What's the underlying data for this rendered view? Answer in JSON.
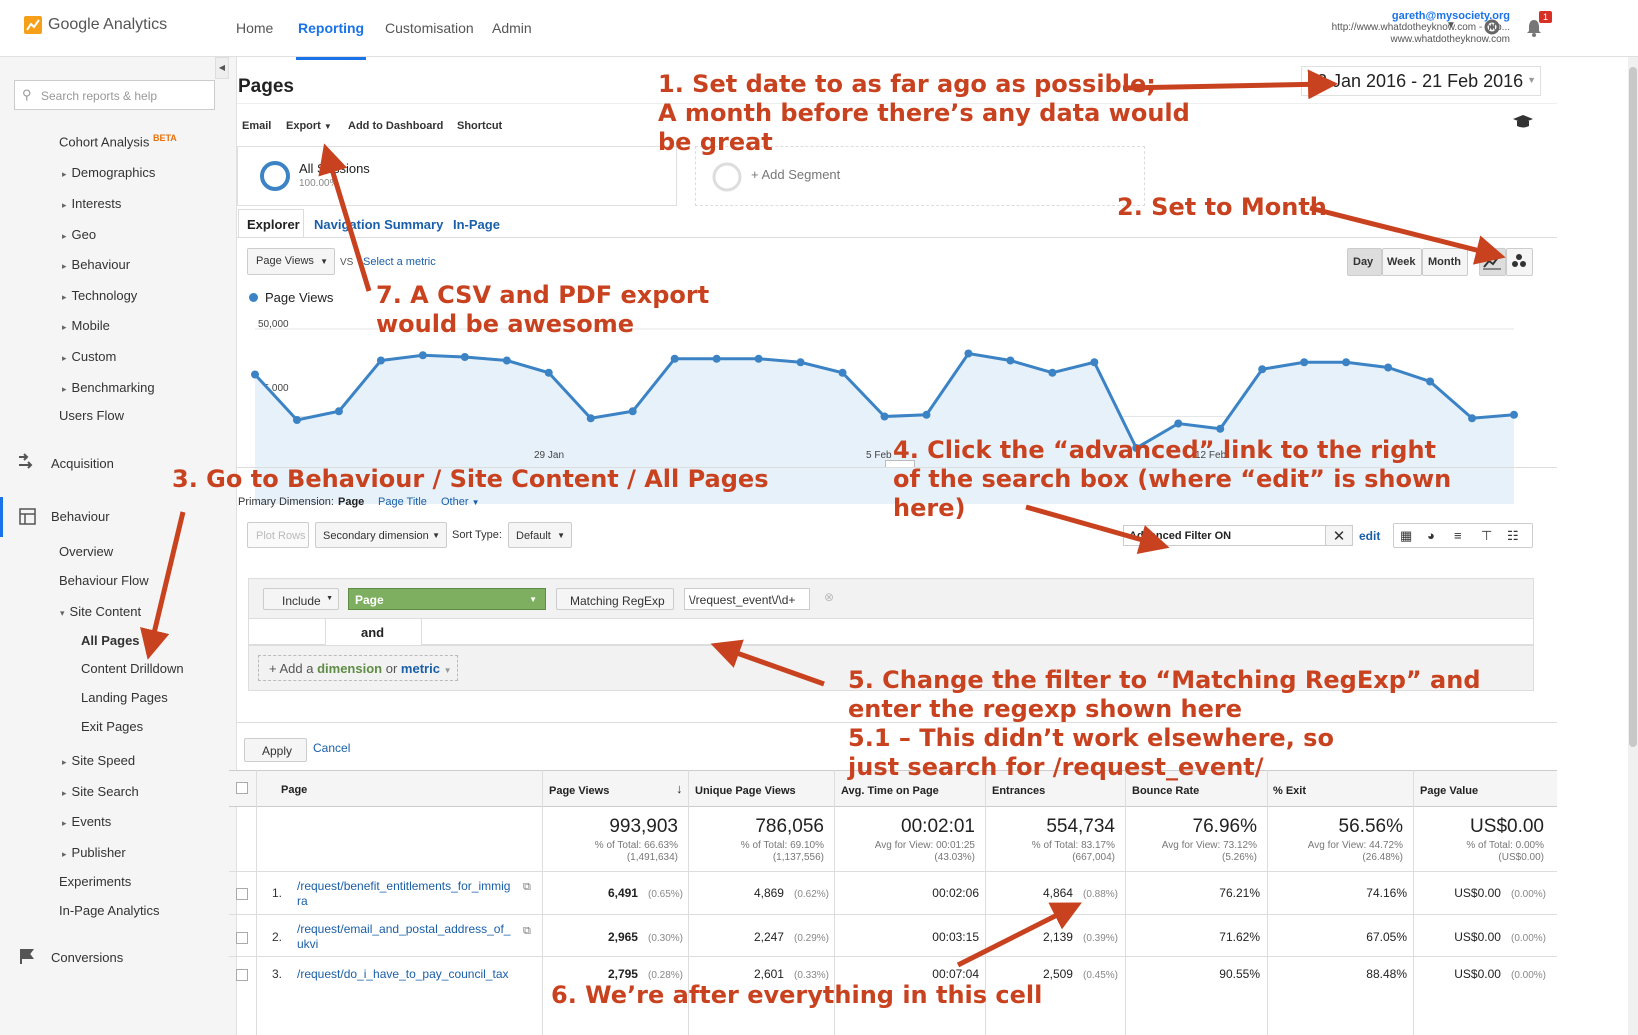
{
  "header": {
    "logo": "Google Analytics",
    "nav": [
      "Home",
      "Reporting",
      "Customisation",
      "Admin"
    ],
    "account_email": "gareth@mysociety.org",
    "account_line1": "http://www.whatdotheyknow.com - http...",
    "account_line2": "www.whatdotheyknow.com",
    "notification_count": "1"
  },
  "sidebar": {
    "search_placeholder": "Search reports & help",
    "cohort": "Cohort Analysis",
    "beta": "BETA",
    "audience_items": [
      "Demographics",
      "Interests",
      "Geo",
      "Behaviour",
      "Technology",
      "Mobile",
      "Custom",
      "Benchmarking"
    ],
    "users_flow": "Users Flow",
    "acquisition": "Acquisition",
    "behaviour": "Behaviour",
    "behaviour_items": [
      "Overview",
      "Behaviour Flow"
    ],
    "site_content": "Site Content",
    "site_content_items": [
      "All Pages",
      "Content Drilldown",
      "Landing Pages",
      "Exit Pages"
    ],
    "behaviour_more": [
      "Site Speed",
      "Site Search",
      "Events",
      "Publisher"
    ],
    "experiments": "Experiments",
    "in_page": "In-Page Analytics",
    "conversions": "Conversions"
  },
  "page": {
    "title": "Pages",
    "date_range": "22 Jan 2016 - 21 Feb 2016",
    "toolbar": [
      "Email",
      "Export",
      "Add to Dashboard",
      "Shortcut"
    ],
    "segment_name": "All Sessions",
    "segment_pct": "100.00%",
    "add_segment": "+ Add Segment",
    "tabs": [
      "Explorer",
      "Navigation Summary",
      "In-Page"
    ],
    "metric_select": "Page Views",
    "vs": "VS",
    "select_metric": "Select a metric",
    "periods": [
      "Day",
      "Week",
      "Month"
    ],
    "legend": "Page Views",
    "y_top": "50,000",
    "y_mid": "25,000",
    "x_labels": [
      "29 Jan",
      "5 Feb",
      "12 Feb"
    ],
    "primary_dimension_label": "Primary Dimension:",
    "dimensions": [
      "Page",
      "Page Title",
      "Other"
    ],
    "plot_rows": "Plot Rows",
    "secondary_dimension": "Secondary dimension",
    "sort_type_label": "Sort Type:",
    "sort_type": "Default",
    "filter_value": "Advanced Filter ON",
    "edit": "edit",
    "filter_include": "Include",
    "filter_dimension": "Page",
    "filter_match": "Matching RegExp",
    "filter_regex": "\\/request_event\\/\\d+",
    "and": "and",
    "add_dimension_prefix": "+ Add a",
    "add_dimension_dim": "dimension",
    "add_dimension_or": "or",
    "add_dimension_metric": "metric",
    "apply": "Apply",
    "cancel": "Cancel"
  },
  "table": {
    "headers": [
      "Page",
      "Page Views",
      "Unique Page Views",
      "Avg. Time on Page",
      "Entrances",
      "Bounce Rate",
      "% Exit",
      "Page Value"
    ],
    "totals": [
      {
        "value": "993,903",
        "l1": "% of Total: 66.63%",
        "l2": "(1,491,634)"
      },
      {
        "value": "786,056",
        "l1": "% of Total: 69.10%",
        "l2": "(1,137,556)"
      },
      {
        "value": "00:02:01",
        "l1": "Avg for View: 00:01:25",
        "l2": "(43.03%)"
      },
      {
        "value": "554,734",
        "l1": "% of Total: 83.17%",
        "l2": "(667,004)"
      },
      {
        "value": "76.96%",
        "l1": "Avg for View: 73.12%",
        "l2": "(5.26%)"
      },
      {
        "value": "56.56%",
        "l1": "Avg for View: 44.72%",
        "l2": "(26.48%)"
      },
      {
        "value": "US$0.00",
        "l1": "% of Total: 0.00%",
        "l2": "(US$0.00)"
      }
    ],
    "rows": [
      {
        "idx": "1.",
        "page1": "/request/benefit_entitlements_for_immig",
        "page2": "ra",
        "pv": "6,491",
        "pvp": "(0.65%)",
        "upv": "4,869",
        "upvp": "(0.62%)",
        "time": "00:02:06",
        "ent": "4,864",
        "entp": "(0.88%)",
        "bounce": "76.21%",
        "exit": "74.16%",
        "val": "US$0.00",
        "valp": "(0.00%)"
      },
      {
        "idx": "2.",
        "page1": "/request/email_and_postal_address_of_",
        "page2": "ukvi",
        "pv": "2,965",
        "pvp": "(0.30%)",
        "upv": "2,247",
        "upvp": "(0.29%)",
        "time": "00:03:15",
        "ent": "2,139",
        "entp": "(0.39%)",
        "bounce": "71.62%",
        "exit": "67.05%",
        "val": "US$0.00",
        "valp": "(0.00%)"
      },
      {
        "idx": "3.",
        "page1": "/request/do_i_have_to_pay_council_tax",
        "page2": "",
        "pv": "2,795",
        "pvp": "(0.28%)",
        "upv": "2,601",
        "upvp": "(0.33%)",
        "time": "00:07:04",
        "ent": "2,509",
        "entp": "(0.45%)",
        "bounce": "90.55%",
        "exit": "88.48%",
        "val": "US$0.00",
        "valp": "(0.00%)"
      }
    ]
  },
  "annotations": {
    "a1": [
      "1. Set date to as far ago as possible;",
      "A month before there’s any data would",
      "be great"
    ],
    "a2": "2. Set to Month",
    "a3": "3. Go to Behaviour / Site Content / All Pages",
    "a4": [
      "4. Click the “advanced” link to the right",
      "of the search box (where “edit” is shown",
      "here)"
    ],
    "a5": [
      "5. Change the filter to “Matching RegExp” and",
      "enter the regexp shown here",
      "5.1 – This didn’t work elsewhere, so",
      "just search for /request_event/"
    ],
    "a6": "6. We’re after everything in this cell",
    "a7": [
      "7. A CSV and PDF export",
      "would be awesome"
    ]
  },
  "chart_data": {
    "type": "line",
    "series": [
      {
        "name": "Page Views",
        "values": [
          37000,
          24000,
          26500,
          41000,
          42500,
          42000,
          41000,
          37500,
          24500,
          26500,
          41500,
          41500,
          41500,
          40500,
          37500,
          25000,
          25500,
          43000,
          41000,
          37500,
          40500,
          16000,
          23000,
          21500,
          38500,
          40500,
          40500,
          39000,
          35000,
          24500,
          25500
        ]
      }
    ],
    "x": [
      "22 Jan",
      "23 Jan",
      "24 Jan",
      "25 Jan",
      "26 Jan",
      "27 Jan",
      "28 Jan",
      "29 Jan",
      "30 Jan",
      "31 Jan",
      "1 Feb",
      "2 Feb",
      "3 Feb",
      "4 Feb",
      "5 Feb",
      "6 Feb",
      "7 Feb",
      "8 Feb",
      "9 Feb",
      "10 Feb",
      "11 Feb",
      "12 Feb",
      "13 Feb",
      "14 Feb",
      "15 Feb",
      "16 Feb",
      "17 Feb",
      "18 Feb",
      "19 Feb",
      "20 Feb",
      "21 Feb"
    ],
    "ylim": [
      0,
      50000
    ],
    "grid": true,
    "legend": "top-left",
    "color": "#3b83c5"
  }
}
